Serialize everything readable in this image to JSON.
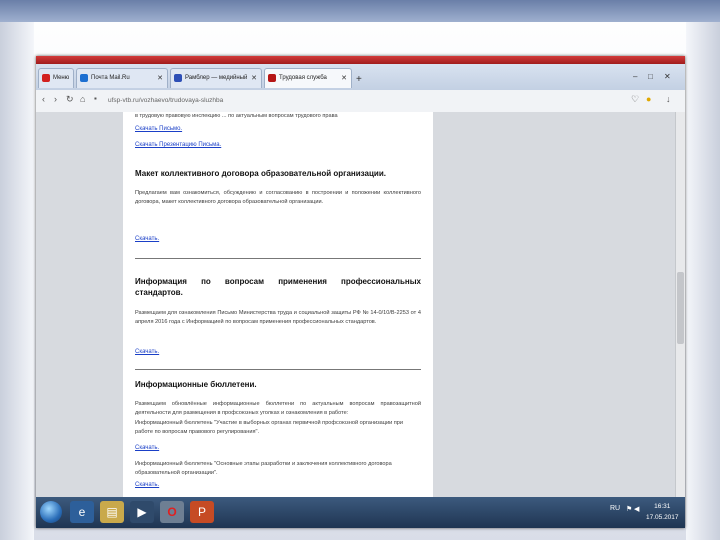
{
  "browser": {
    "tabs": [
      {
        "label": "Меню",
        "color": "#d2201f"
      },
      {
        "label": "Почта Mail.Ru",
        "color": "#1c6fd1"
      },
      {
        "label": "Рамблер — медийный",
        "color": "#2d4fb6"
      },
      {
        "label": "Трудовая служба",
        "color": "#b51616"
      }
    ],
    "new_tab_glyph": "+",
    "url": "ufsp-vtb.ru/vozhaevo/trudovaya-sluzhba",
    "window_controls": [
      "–",
      "□",
      "✕"
    ]
  },
  "page": {
    "top_line": "в трудовую правовую инспекцию ... по актуальным вопросам трудового права",
    "links_top": [
      "Скачать Письмо.",
      "Скачать Презентацию Письма."
    ],
    "sections": [
      {
        "heading": "Макет коллективного договора образовательной организации.",
        "body": "Предлагаем вам ознакомиться, обсуждению и согласованию в построении и положении коллективного договора, макет коллективного договора образовательной организации.",
        "link": "Скачать."
      },
      {
        "heading": "Информация по вопросам применения профессиональных стандартов.",
        "body": "Размещаем для ознакомления Письмо Министерства труда и социальной защиты РФ № 14-0/10/В-2253 от 4 апреля 2016 года с Информацией по вопросам применения профессиональных стандартов.",
        "link": "Скачать."
      },
      {
        "heading": "Информационные бюллетени.",
        "body": "Размещаем обновлённые информационные бюллетени по актуальным вопросам правозащитной деятельности для размещения в профсоюзных уголках и ознакомления в работе:",
        "items": [
          {
            "text": "Информационный бюллетень \"Участие в выборных органах первичной профсоюзной организации при работе по вопросам правового регулирования\".",
            "link": "Скачать."
          },
          {
            "text": "Информационный бюллетень \"Основные этапы разработки и заключения коллективного договора образовательной организации\".",
            "link": "Скачать."
          }
        ]
      }
    ]
  },
  "taskbar": {
    "language": "RU",
    "time": "16:31",
    "date": "17.05.2017"
  }
}
